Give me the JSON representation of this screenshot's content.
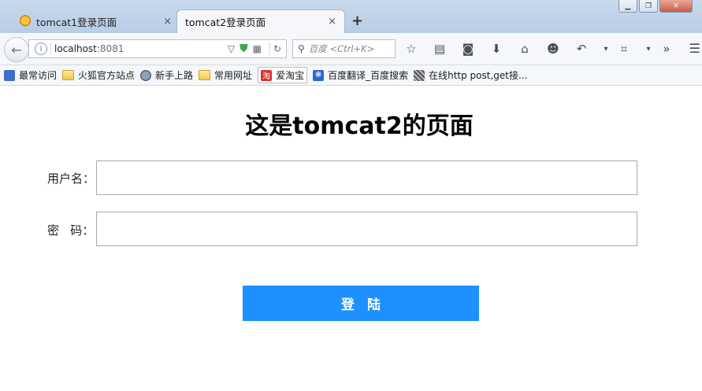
{
  "browser": {
    "tabs": [
      {
        "title": "tomcat1登录页面",
        "close": "×"
      },
      {
        "title": "tomcat2登录页面",
        "close": "×"
      }
    ],
    "new_tab": "+",
    "url": {
      "host": "localhost",
      "port": ":8081"
    },
    "search_placeholder": "百度 <Ctrl+K>",
    "bookmarks": [
      {
        "label": "最常访问",
        "icon": "bookmark-star-icon"
      },
      {
        "label": "火狐官方站点",
        "icon": "folder-icon"
      },
      {
        "label": "新手上路",
        "icon": "globe-icon"
      },
      {
        "label": "常用网址",
        "icon": "folder-icon"
      },
      {
        "label": "爱淘宝",
        "icon": "taobao-icon",
        "icon_text": "淘"
      },
      {
        "label": "百度翻译_百度搜索",
        "icon": "baidu-paw-icon"
      },
      {
        "label": "在线http post,get接...",
        "icon": "qr-icon"
      }
    ]
  },
  "page": {
    "title": "这是tomcat2的页面",
    "username_label": "用户名：",
    "password_label": "密   码：",
    "username_value": "",
    "password_value": "",
    "login_button": "登陆"
  },
  "colors": {
    "button": "#1e90ff",
    "button_text": "#ffffff"
  }
}
